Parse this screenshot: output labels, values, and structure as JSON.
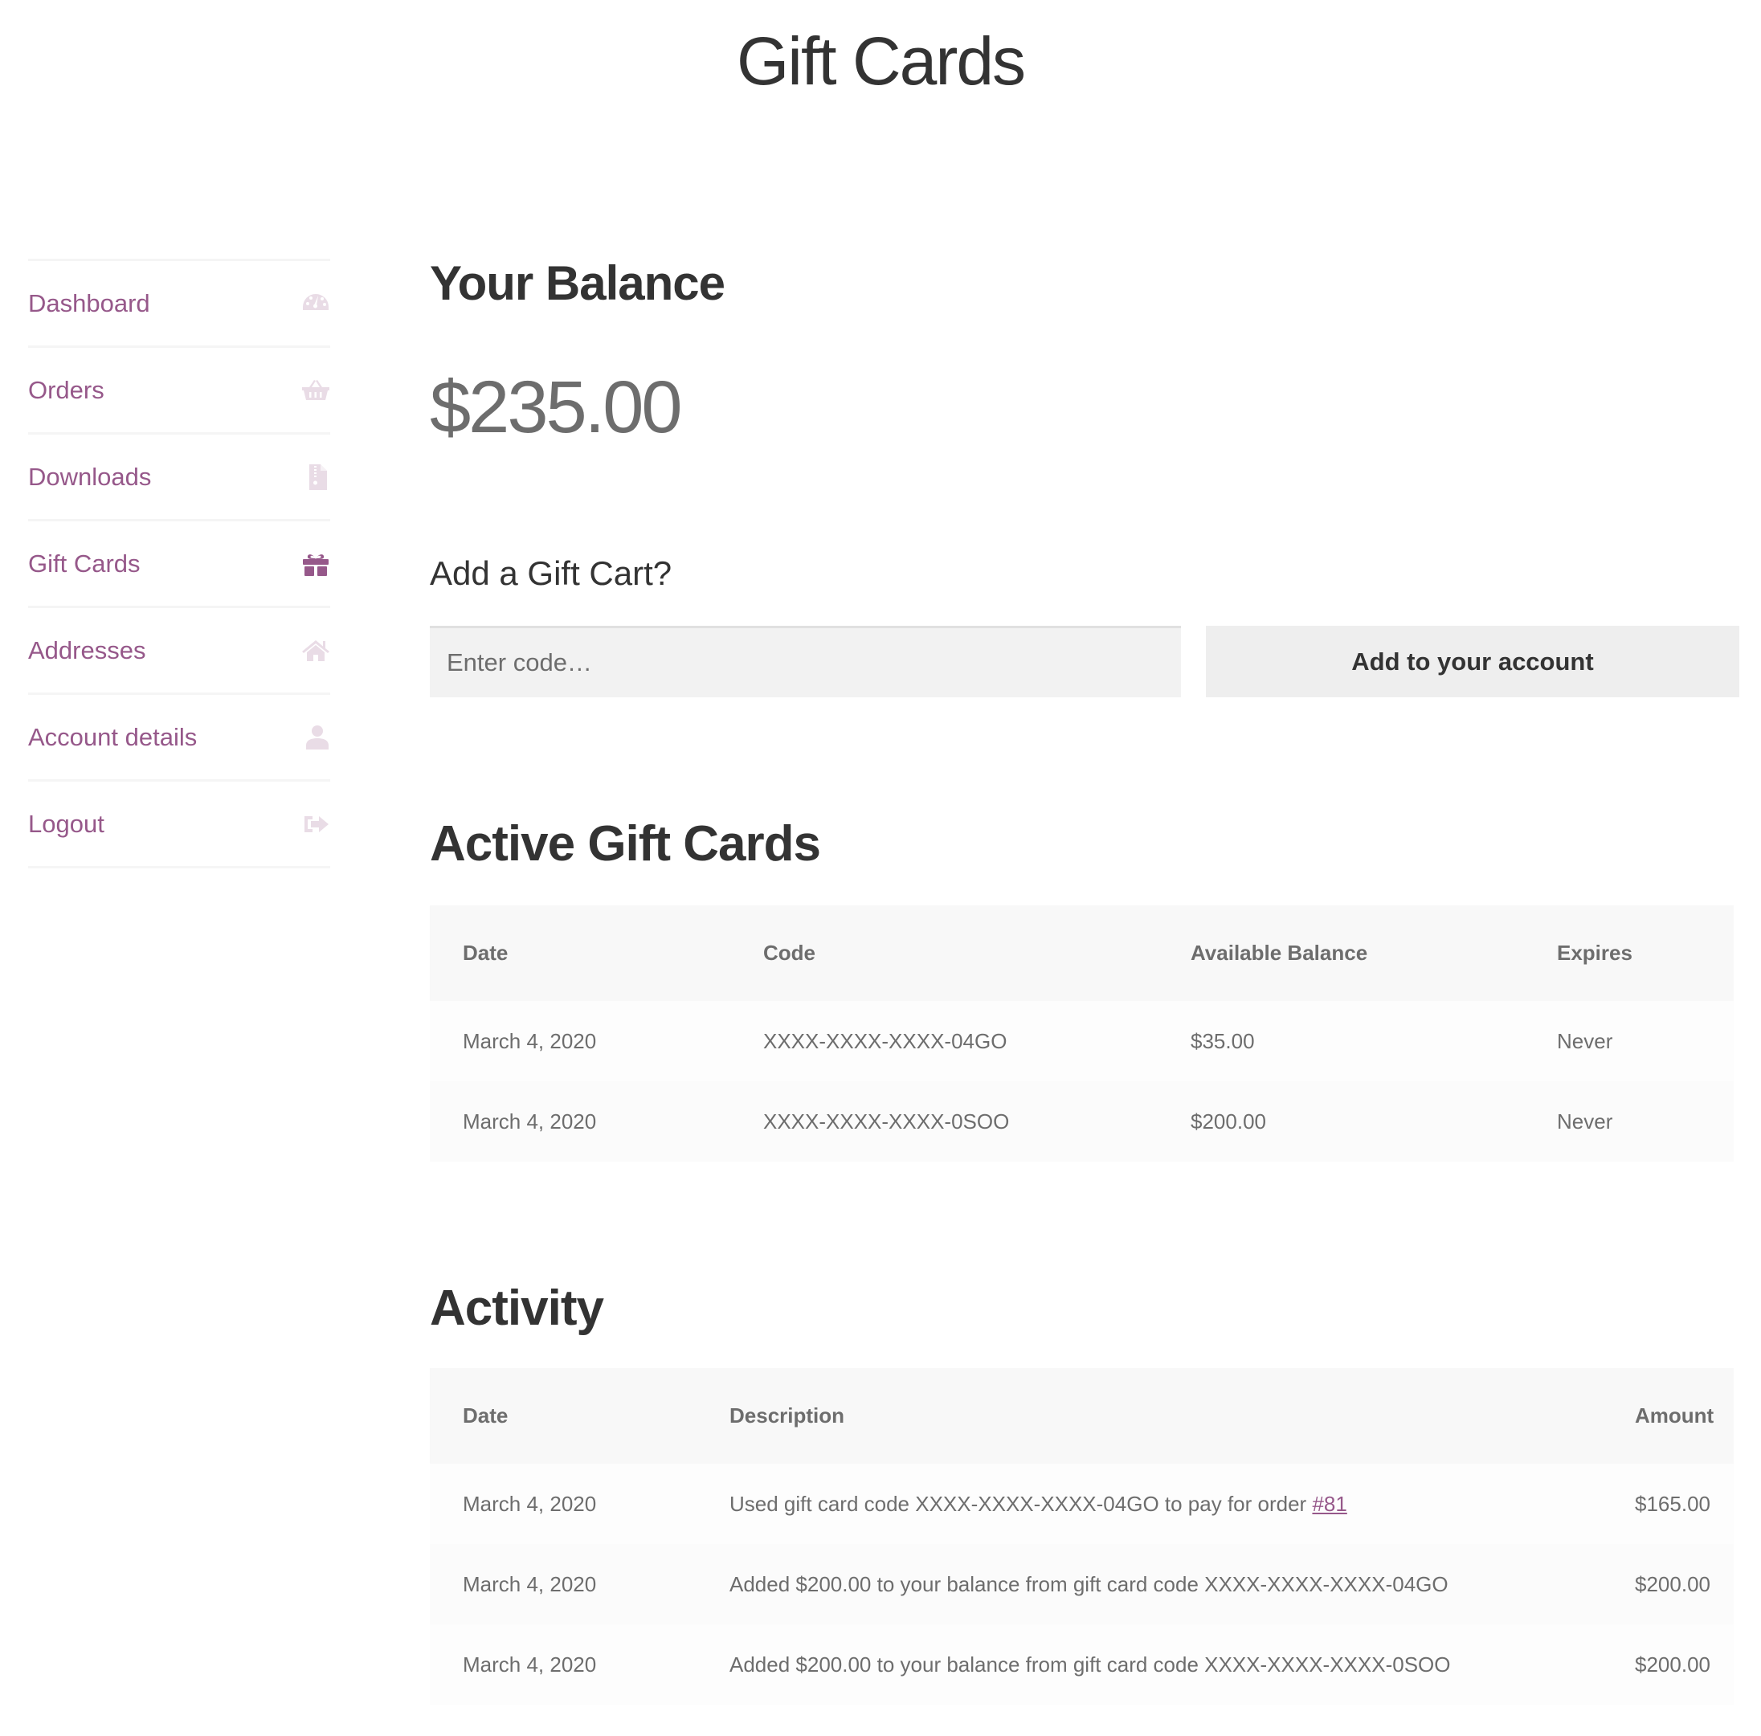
{
  "page": {
    "title": "Gift Cards"
  },
  "colors": {
    "accent": "#96588a",
    "icon_muted": "#e9dce6",
    "text": "#333333",
    "text_muted": "#6d6d6d"
  },
  "sidebar": {
    "items": [
      {
        "label": "Dashboard",
        "icon": "dashboard-gauge-icon",
        "active": false
      },
      {
        "label": "Orders",
        "icon": "basket-icon",
        "active": false
      },
      {
        "label": "Downloads",
        "icon": "file-archive-icon",
        "active": false
      },
      {
        "label": "Gift Cards",
        "icon": "gift-icon",
        "active": true
      },
      {
        "label": "Addresses",
        "icon": "home-icon",
        "active": false
      },
      {
        "label": "Account details",
        "icon": "user-icon",
        "active": false
      },
      {
        "label": "Logout",
        "icon": "sign-out-icon",
        "active": false
      }
    ]
  },
  "balance": {
    "title": "Your Balance",
    "amount": "$235.00"
  },
  "add_card": {
    "title": "Add a Gift Cart?",
    "input_placeholder": "Enter code…",
    "input_value": "",
    "button_label": "Add to your account"
  },
  "active_cards": {
    "title": "Active Gift Cards",
    "columns": [
      "Date",
      "Code",
      "Available Balance",
      "Expires"
    ],
    "rows": [
      {
        "date": "March 4, 2020",
        "code": "XXXX-XXXX-XXXX-04GO",
        "balance": "$35.00",
        "expires": "Never"
      },
      {
        "date": "March 4, 2020",
        "code": "XXXX-XXXX-XXXX-0SOO",
        "balance": "$200.00",
        "expires": "Never"
      }
    ]
  },
  "activity": {
    "title": "Activity",
    "columns": [
      "Date",
      "Description",
      "Amount"
    ],
    "rows": [
      {
        "date": "March 4, 2020",
        "description": "Used gift card code XXXX-XXXX-XXXX-04GO to pay for order ",
        "link": "#81",
        "amount": "$165.00"
      },
      {
        "date": "March 4, 2020",
        "description": "Added $200.00 to your balance from gift card code XXXX-XXXX-XXXX-04GO",
        "link": "",
        "amount": "$200.00"
      },
      {
        "date": "March 4, 2020",
        "description": "Added $200.00 to your balance from gift card code XXXX-XXXX-XXXX-0SOO",
        "link": "",
        "amount": "$200.00"
      }
    ]
  }
}
